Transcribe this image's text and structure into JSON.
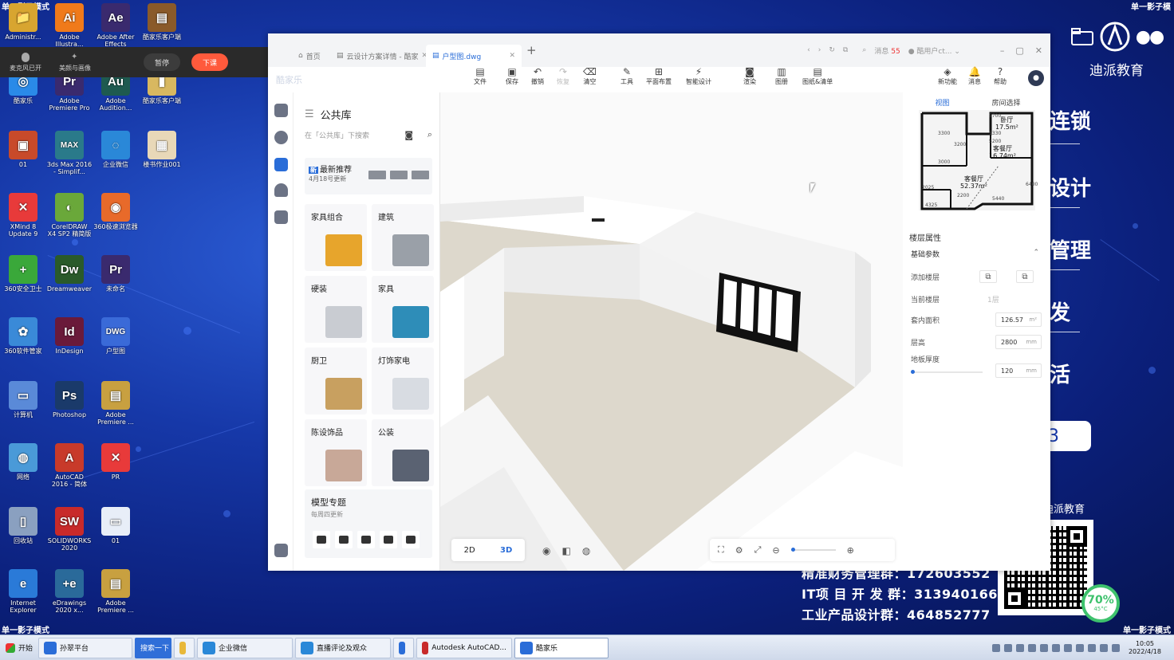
{
  "desktop": {
    "corner_top_left": "单一影子模式",
    "corner_top_right": "单一影子模",
    "corner_bottom_left": "单一影子模式",
    "corner_bottom_right": "单一影子模式",
    "icons": [
      {
        "label": "Administr...",
        "glyph": "📁",
        "color": "#d8a530"
      },
      {
        "label": "Adobe Illustra...",
        "glyph": "Ai",
        "color": "#f07a1a"
      },
      {
        "label": "Adobe After Effects",
        "glyph": "Ae",
        "color": "#3a2a6e"
      },
      {
        "label": "酷家乐客户端",
        "glyph": "▤",
        "color": "#8a5a2a"
      },
      {
        "label": "酷家乐",
        "glyph": "◎",
        "color": "#2a8ae8"
      },
      {
        "label": "Adobe Premiere Pro",
        "glyph": "Pr",
        "color": "#3a2a6e"
      },
      {
        "label": "Adobe Audition...",
        "glyph": "Au",
        "color": "#1e5a50"
      },
      {
        "label": "酷家乐客户端",
        "glyph": "▮",
        "color": "#d8b860"
      },
      {
        "label": "01",
        "glyph": "▣",
        "color": "#c84a2a"
      },
      {
        "label": "3ds Max 2016 - Simplif...",
        "glyph": "MAX",
        "color": "#2a7a8a"
      },
      {
        "label": "企业微信",
        "glyph": "◌",
        "color": "#2a88d8"
      },
      {
        "label": "楼书作业001",
        "glyph": "▦",
        "color": "#e8d8b8"
      },
      {
        "label": "XMind 8 Update 9",
        "glyph": "✕",
        "color": "#e83a3a"
      },
      {
        "label": "CorelDRAW X4 SP2 精简版",
        "glyph": "◐",
        "color": "#6aa83a"
      },
      {
        "label": "360极速浏览器",
        "glyph": "◉",
        "color": "#e86a2a"
      },
      {
        "label": "360安全卫士",
        "glyph": "+",
        "color": "#3aa83a"
      },
      {
        "label": "Dreamweaver",
        "glyph": "Dw",
        "color": "#2a5a2a"
      },
      {
        "label": "未命名",
        "glyph": "Pr",
        "color": "#3a2a6e"
      },
      {
        "label": "360软件管家",
        "glyph": "✿",
        "color": "#3a8ad8"
      },
      {
        "label": "InDesign",
        "glyph": "Id",
        "color": "#6a1a3a"
      },
      {
        "label": "户型图",
        "glyph": "DWG",
        "color": "#3a6ad8"
      },
      {
        "label": "计算机",
        "glyph": "▭",
        "color": "#5a8ad8"
      },
      {
        "label": "Photoshop",
        "glyph": "Ps",
        "color": "#1a3a6a"
      },
      {
        "label": "Adobe Premiere ...",
        "glyph": "▤",
        "color": "#c8a040"
      },
      {
        "label": "网络",
        "glyph": "◍",
        "color": "#4a9ad8"
      },
      {
        "label": "AutoCAD 2016 - 简体中...",
        "glyph": "A",
        "color": "#c83a2a"
      },
      {
        "label": "PR",
        "glyph": "✕",
        "color": "#e83a3a"
      },
      {
        "label": "回收站",
        "glyph": "▯",
        "color": "#8aa0c0"
      },
      {
        "label": "SOLIDWORKS 2020",
        "glyph": "SW",
        "color": "#c82a2a"
      },
      {
        "label": "01",
        "glyph": "▭",
        "color": "#e8eef8"
      },
      {
        "label": "Internet Explorer",
        "glyph": "e",
        "color": "#2a7ad8"
      },
      {
        "label": "eDrawings 2020 x...",
        "glyph": "+e",
        "color": "#2a6a9a"
      },
      {
        "label": "Adobe Premiere ...",
        "glyph": "▤",
        "color": "#c8a040"
      }
    ],
    "recorder": {
      "item1": "麦克风已开",
      "item2": "美颜与画像",
      "pause": "暂停",
      "stop": "下课"
    },
    "brand": {
      "name": "迪派教育"
    },
    "ad": {
      "t1": "连锁",
      "t2": "设计",
      "t3": "管理",
      "t4": "发",
      "t5": "活",
      "button": "3",
      "dipai": "迪派教育",
      "line1": "精准财务管理群：172603552",
      "line2": "IT项 目 开 发 群：313940166",
      "line3": "工业产品设计群：464852777"
    },
    "gauge": {
      "pct": "70%",
      "temp": "45°C"
    }
  },
  "app": {
    "tabs": [
      {
        "label": "首页"
      },
      {
        "label": "云设计方案详情 - 酷家"
      },
      {
        "label": "户型图.dwg",
        "active": true
      }
    ],
    "tab_add": "+",
    "msg_label": "消息",
    "msg_count": "55",
    "user": "酷用户ct...",
    "logo_faint": "酷家乐",
    "tools": [
      {
        "label": "文件",
        "icon": "▤"
      },
      {
        "label": "保存",
        "icon": "▣"
      },
      {
        "label": "撤销",
        "icon": "↶"
      },
      {
        "label": "恢复",
        "icon": "↷",
        "disabled": true
      },
      {
        "label": "清空",
        "icon": "⌫"
      },
      {
        "label": "工具",
        "icon": "✎"
      },
      {
        "label": "平面布置",
        "icon": "⊞"
      },
      {
        "label": "智能设计",
        "icon": "⚡"
      },
      {
        "label": "渲染",
        "icon": "◙"
      },
      {
        "label": "图册",
        "icon": "▥"
      },
      {
        "label": "图纸&清单",
        "icon": "▤"
      },
      {
        "label": "新功能",
        "icon": "◈"
      },
      {
        "label": "消息",
        "icon": "🔔"
      },
      {
        "label": "帮助",
        "icon": "?"
      }
    ],
    "avatar": "●",
    "library": {
      "title": "公共库",
      "search_placeholder": "在「公共库」下搜索",
      "new_badge": "新",
      "new_title": "最新推荐",
      "new_date": "4月18号更新",
      "categories": [
        {
          "label": "家具组合",
          "pic": "#e7a52c"
        },
        {
          "label": "建筑",
          "pic": "#9aa0a8"
        },
        {
          "label": "硬装",
          "pic": "#c9ccd2"
        },
        {
          "label": "家具",
          "pic": "#2e8db8"
        },
        {
          "label": "厨卫",
          "pic": "#c8a060"
        },
        {
          "label": "灯饰家电",
          "pic": "#d8dce2"
        },
        {
          "label": "陈设饰品",
          "pic": "#c8a898"
        },
        {
          "label": "公装",
          "pic": "#5a6272"
        }
      ],
      "topic_title": "模型专题",
      "topic_date": "每周四更新"
    },
    "view": {
      "mode_2d": "2D",
      "mode_3d": "3D"
    },
    "right": {
      "tab_view": "视图",
      "tab_room": "房间选择",
      "rooms": [
        {
          "name": "卧厅",
          "area": "17.5m²"
        },
        {
          "name": "客餐厅",
          "area": "16.74m²"
        },
        {
          "name": "客餐厅",
          "area": "52.37m²"
        }
      ],
      "dims": [
        "3300",
        "3000",
        "3200",
        "5700",
        "5200",
        "5330",
        "2025",
        "2200",
        "4325",
        "5440",
        "6400"
      ],
      "floor_props": "楼层属性",
      "basic": "基础参数",
      "add_floor": "添加楼层",
      "cur_floor": "当前楼层",
      "cur_floor_val": "1层",
      "inner_area": "套内面积",
      "inner_area_val": "126.57",
      "inner_area_unit": "m²",
      "height": "层高",
      "height_val": "2800",
      "height_unit": "mm",
      "thick": "地板厚度",
      "thick_val": "120",
      "thick_unit": "mm"
    }
  },
  "taskbar": {
    "start": "开始",
    "items": [
      {
        "label": "孙翠平台"
      },
      {
        "label": "搜索一下"
      },
      {
        "label": ""
      },
      {
        "label": "企业微信"
      },
      {
        "label": "直播评论及观众"
      },
      {
        "label": ""
      },
      {
        "label": "Autodesk AutoCAD..."
      },
      {
        "label": "酷家乐"
      }
    ],
    "time": "10:05",
    "date": "2022/4/18"
  }
}
